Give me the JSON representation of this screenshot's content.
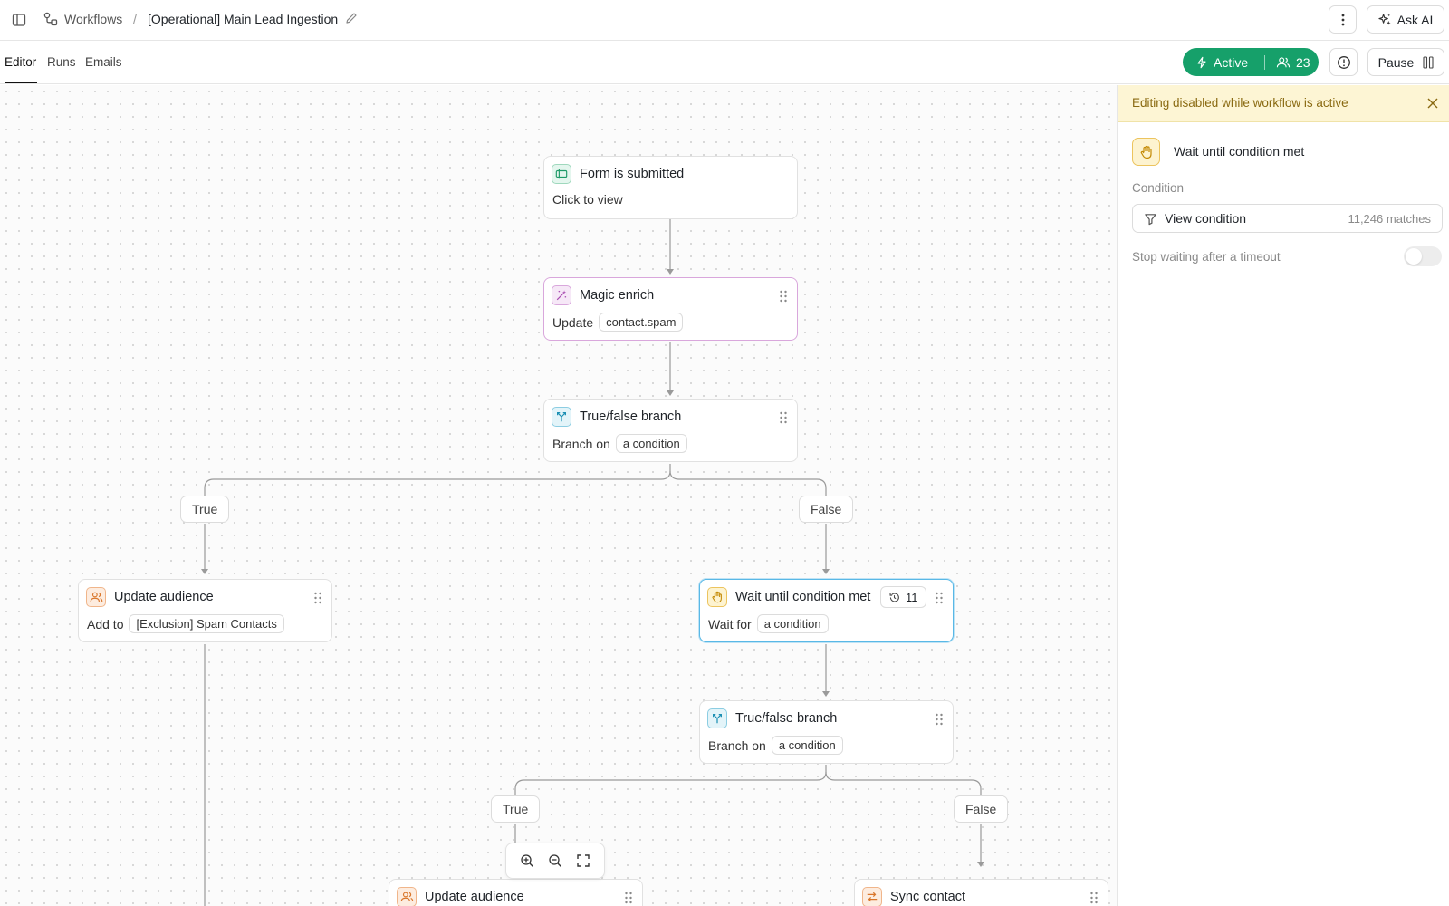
{
  "breadcrumb": {
    "root": "Workflows",
    "separator": "/",
    "current": "[Operational] Main Lead Ingestion"
  },
  "header": {
    "ask_ai_label": "Ask AI"
  },
  "tabs": [
    {
      "label": "Editor",
      "active": true
    },
    {
      "label": "Runs",
      "active": false
    },
    {
      "label": "Emails",
      "active": false
    }
  ],
  "status": {
    "label": "Active",
    "count": "23",
    "color": "#16a06a"
  },
  "pause_label": "Pause",
  "nodes": {
    "form": {
      "title": "Form is submitted",
      "line": "Click to view",
      "icon": "form-icon"
    },
    "magic": {
      "title": "Magic enrich",
      "prefix": "Update",
      "chip": "contact.spam",
      "icon": "magic-wand-icon"
    },
    "branch1": {
      "title": "True/false branch",
      "prefix": "Branch on",
      "chip": "a condition",
      "icon": "branch-icon"
    },
    "audience1": {
      "title": "Update audience",
      "prefix": "Add to",
      "chip": "[Exclusion] Spam Contacts",
      "icon": "users-icon"
    },
    "wait": {
      "title": "Wait until condition met",
      "prefix": "Wait for",
      "chip": "a condition",
      "counter": "11",
      "icon": "hand-icon"
    },
    "branch2": {
      "title": "True/false branch",
      "prefix": "Branch on",
      "chip": "a condition",
      "icon": "branch-icon"
    },
    "audience2": {
      "title": "Update audience",
      "icon": "users-icon"
    },
    "sync": {
      "title": "Sync contact",
      "icon": "sync-icon"
    }
  },
  "branch_labels": {
    "true1": "True",
    "false1": "False",
    "true2": "True",
    "false2": "False"
  },
  "panel": {
    "banner": "Editing disabled while workflow is active",
    "step_title": "Wait until condition met",
    "condition_label": "Condition",
    "view_condition": "View condition",
    "matches": "11,246 matches",
    "timeout_label": "Stop waiting after a timeout",
    "timeout_enabled": false
  }
}
